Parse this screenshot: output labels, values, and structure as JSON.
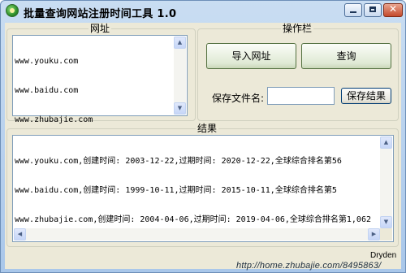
{
  "window": {
    "title": "批量查询网站注册时间工具 1.0"
  },
  "url_group": {
    "legend": "网址",
    "urls": [
      "www.youku.com",
      "www.baidu.com",
      "www.zhubajie.com"
    ]
  },
  "ops_group": {
    "legend": "操作栏",
    "import_button": "导入网址",
    "query_button": "查询",
    "save_filename_label": "保存文件名:",
    "save_filename_value": "",
    "save_button": "保存结果"
  },
  "results_group": {
    "legend": "结果",
    "lines": [
      "www.youku.com,创建时间: 2003-12-22,过期时间: 2020-12-22,全球综合排名第56",
      "www.baidu.com,创建时间: 1999-10-11,过期时间: 2015-10-11,全球综合排名第5",
      "www.zhubajie.com,创建时间: 2004-04-06,过期时间: 2019-04-06,全球综合排名第1,062"
    ]
  },
  "footer": {
    "author": "Dryden"
  },
  "watermark": "http://home.zhubajie.com/8495863/",
  "icons": {
    "app": "app-globe-icon",
    "minimize": "minimize-icon",
    "maximize": "maximize-icon",
    "close": "close-icon",
    "scroll_up": "scroll-up-arrow-icon",
    "scroll_down": "scroll-down-arrow-icon",
    "scroll_left": "scroll-left-arrow-icon",
    "scroll_right": "scroll-right-arrow-icon"
  },
  "colors": {
    "titlebar": "#b9d1ee",
    "client": "#ece9d8",
    "close_button": "#c44a2c",
    "field_border": "#7f9db9"
  }
}
